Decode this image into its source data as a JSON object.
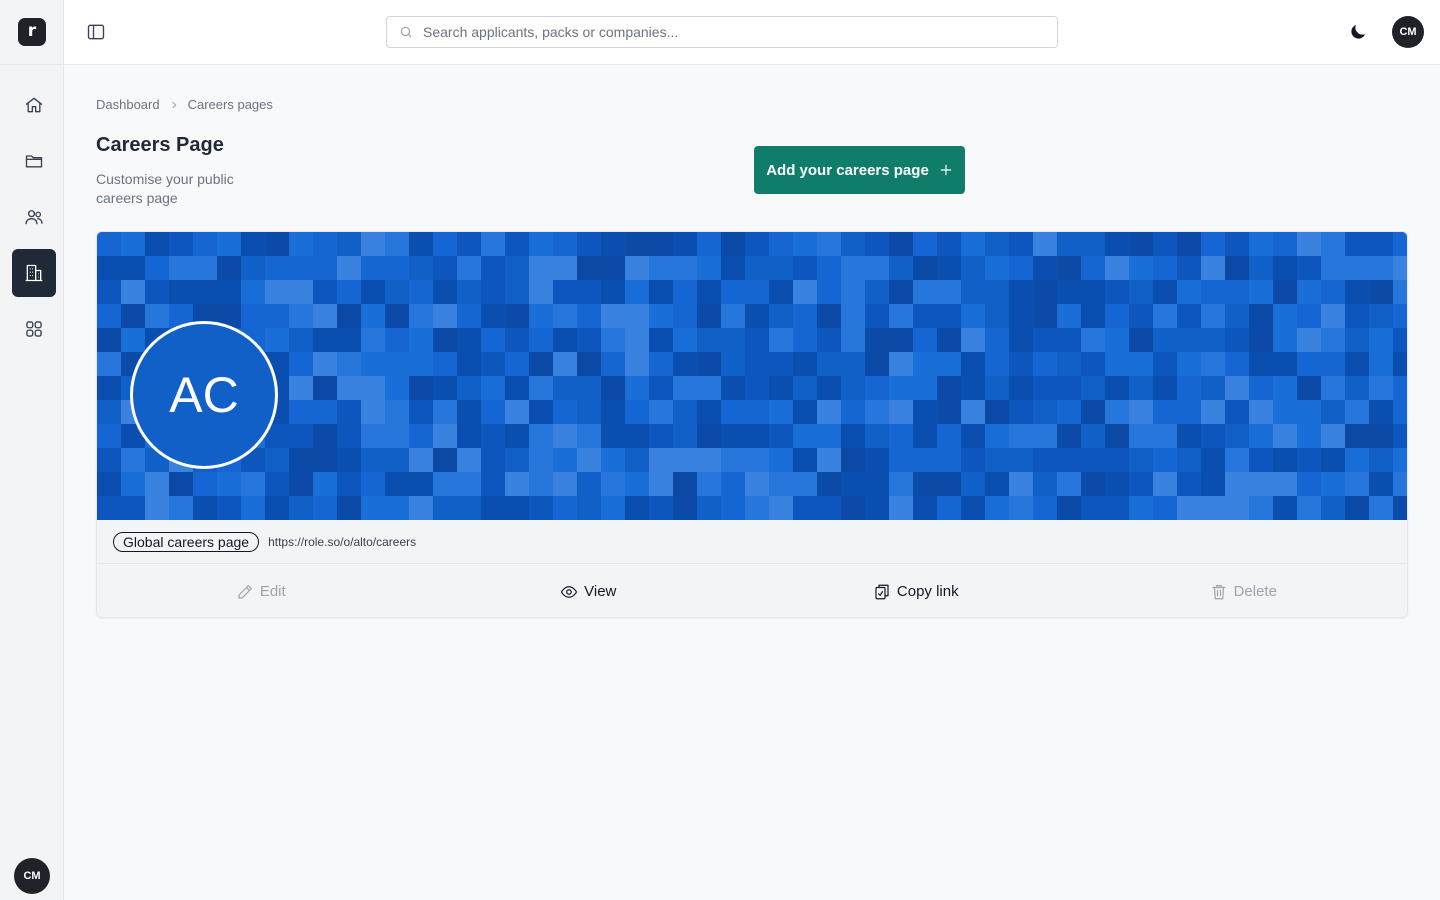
{
  "app": {
    "logo_letter": "r"
  },
  "user": {
    "initials": "CM"
  },
  "search": {
    "placeholder": "Search applicants, packs or companies..."
  },
  "sidebar": {
    "items": [
      {
        "name": "home",
        "icon": "home-icon",
        "active": false
      },
      {
        "name": "packs",
        "icon": "folder-icon",
        "active": false
      },
      {
        "name": "applicants",
        "icon": "users-icon",
        "active": false
      },
      {
        "name": "companies",
        "icon": "building-icon",
        "active": true
      },
      {
        "name": "apps",
        "icon": "grid-icon",
        "active": false
      }
    ]
  },
  "breadcrumb": [
    "Dashboard",
    "Careers pages"
  ],
  "page": {
    "title": "Careers Page",
    "subtitle": "Customise your public careers page",
    "add_button": "Add your careers page"
  },
  "careers_card": {
    "company_initials": "AC",
    "tag": "Global careers page",
    "url": "https://role.so/o/alto/careers",
    "banner_color": "#1160c8",
    "actions": [
      {
        "label": "Edit",
        "icon": "pencil-icon",
        "enabled": false
      },
      {
        "label": "View",
        "icon": "eye-icon",
        "enabled": true
      },
      {
        "label": "Copy link",
        "icon": "clipboard-icon",
        "enabled": true
      },
      {
        "label": "Delete",
        "icon": "trash-icon",
        "enabled": false
      }
    ]
  },
  "colors": {
    "primary": "#0f7d6a",
    "sidebar_active": "#1f2937"
  }
}
